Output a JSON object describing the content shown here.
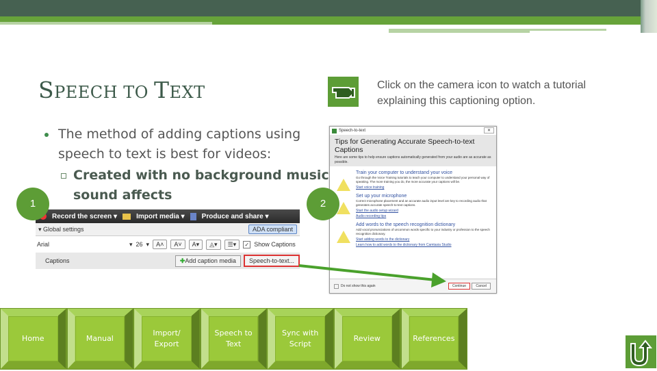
{
  "slide": {
    "title_first": "S",
    "title_rest1": "PEECH TO ",
    "title_second": "T",
    "title_rest2": "EXT",
    "tutorial_text_line1": "Click on the camera icon to watch a tutorial",
    "tutorial_text_line2": "explaining this captioning option.",
    "bullet_main": "The method of adding captions using speech to text is best for videos:",
    "bullet_sub": "Created with no background music or sound affects",
    "step1_label": "1",
    "step2_label": "2"
  },
  "camtasia": {
    "record_label": "Record the screen ▾",
    "import_label": "Import media ▾",
    "produce_label": "Produce and share ▾",
    "global_settings": "▾ Global settings",
    "ada_button": "ADA compliant",
    "font_value": "Arial",
    "font_size": "26",
    "show_captions": "Show Captions",
    "show_captions_checked": true,
    "captions_label": "Captions",
    "add_caption_media": "Add caption media",
    "speech_to_text_button": "Speech-to-text..."
  },
  "dialog": {
    "window_title": "Speech-to-text",
    "heading": "Tips for Generating Accurate Speech-to-text Captions",
    "intro": "Here are some tips to help ensure captions automatically generated from your audio are as accurate as possible.",
    "tips": [
      {
        "title": "Train your computer to understand your voice",
        "body": "Go through the Voice Training tutorials to teach your computer to understand your personal way of speaking. The more training you do, the more accurate your captions will be.",
        "links": [
          "Start voice training"
        ]
      },
      {
        "title": "Set up your microphone",
        "body": "Correct microphone placement and an accurate audio input level are key to recording audio that generates accurate speech-to-text captions.",
        "links": [
          "Start the audio setup wizard",
          "Audio recording tips"
        ]
      },
      {
        "title": "Add words to the speech recognition dictionary",
        "body": "Add vocal pronunciations of uncommon words specific to your industry or profession to the speech recognition dictionary.",
        "links": [
          "Start adding words to the dictionary",
          "Learn how to add words to the dictionary from Camtasia Studio"
        ]
      }
    ],
    "dont_show": "Do not show this again",
    "continue_button": "Continue",
    "cancel_button": "Cancel"
  },
  "nav": {
    "buttons": [
      {
        "label": "Home"
      },
      {
        "label": "Manual"
      },
      {
        "label": "Import/\nExport"
      },
      {
        "label": "Speech to\nText"
      },
      {
        "label": "Sync with\nScript"
      },
      {
        "label": "Review"
      },
      {
        "label": "References"
      }
    ]
  },
  "icons": {
    "camera": "video-camera-icon",
    "return": "u-turn-return-icon"
  },
  "colors": {
    "header_dark": "#466151",
    "accent_green": "#67a33a",
    "nav_green": "#9bc93a",
    "title_color": "#3d5a4a",
    "highlight_red": "#d33333"
  }
}
